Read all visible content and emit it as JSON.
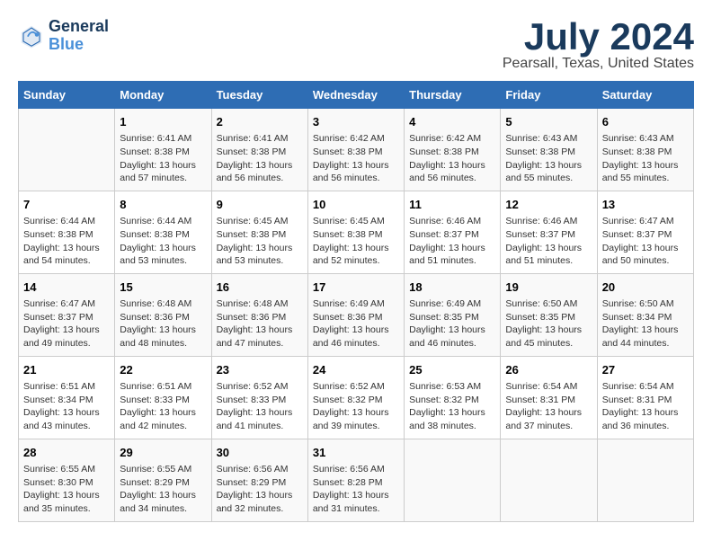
{
  "header": {
    "logo_line1": "General",
    "logo_line2": "Blue",
    "title": "July 2024",
    "subtitle": "Pearsall, Texas, United States"
  },
  "calendar": {
    "days_of_week": [
      "Sunday",
      "Monday",
      "Tuesday",
      "Wednesday",
      "Thursday",
      "Friday",
      "Saturday"
    ],
    "weeks": [
      [
        {
          "day": "",
          "content": ""
        },
        {
          "day": "1",
          "content": "Sunrise: 6:41 AM\nSunset: 8:38 PM\nDaylight: 13 hours\nand 57 minutes."
        },
        {
          "day": "2",
          "content": "Sunrise: 6:41 AM\nSunset: 8:38 PM\nDaylight: 13 hours\nand 56 minutes."
        },
        {
          "day": "3",
          "content": "Sunrise: 6:42 AM\nSunset: 8:38 PM\nDaylight: 13 hours\nand 56 minutes."
        },
        {
          "day": "4",
          "content": "Sunrise: 6:42 AM\nSunset: 8:38 PM\nDaylight: 13 hours\nand 56 minutes."
        },
        {
          "day": "5",
          "content": "Sunrise: 6:43 AM\nSunset: 8:38 PM\nDaylight: 13 hours\nand 55 minutes."
        },
        {
          "day": "6",
          "content": "Sunrise: 6:43 AM\nSunset: 8:38 PM\nDaylight: 13 hours\nand 55 minutes."
        }
      ],
      [
        {
          "day": "7",
          "content": "Sunrise: 6:44 AM\nSunset: 8:38 PM\nDaylight: 13 hours\nand 54 minutes."
        },
        {
          "day": "8",
          "content": "Sunrise: 6:44 AM\nSunset: 8:38 PM\nDaylight: 13 hours\nand 53 minutes."
        },
        {
          "day": "9",
          "content": "Sunrise: 6:45 AM\nSunset: 8:38 PM\nDaylight: 13 hours\nand 53 minutes."
        },
        {
          "day": "10",
          "content": "Sunrise: 6:45 AM\nSunset: 8:38 PM\nDaylight: 13 hours\nand 52 minutes."
        },
        {
          "day": "11",
          "content": "Sunrise: 6:46 AM\nSunset: 8:37 PM\nDaylight: 13 hours\nand 51 minutes."
        },
        {
          "day": "12",
          "content": "Sunrise: 6:46 AM\nSunset: 8:37 PM\nDaylight: 13 hours\nand 51 minutes."
        },
        {
          "day": "13",
          "content": "Sunrise: 6:47 AM\nSunset: 8:37 PM\nDaylight: 13 hours\nand 50 minutes."
        }
      ],
      [
        {
          "day": "14",
          "content": "Sunrise: 6:47 AM\nSunset: 8:37 PM\nDaylight: 13 hours\nand 49 minutes."
        },
        {
          "day": "15",
          "content": "Sunrise: 6:48 AM\nSunset: 8:36 PM\nDaylight: 13 hours\nand 48 minutes."
        },
        {
          "day": "16",
          "content": "Sunrise: 6:48 AM\nSunset: 8:36 PM\nDaylight: 13 hours\nand 47 minutes."
        },
        {
          "day": "17",
          "content": "Sunrise: 6:49 AM\nSunset: 8:36 PM\nDaylight: 13 hours\nand 46 minutes."
        },
        {
          "day": "18",
          "content": "Sunrise: 6:49 AM\nSunset: 8:35 PM\nDaylight: 13 hours\nand 46 minutes."
        },
        {
          "day": "19",
          "content": "Sunrise: 6:50 AM\nSunset: 8:35 PM\nDaylight: 13 hours\nand 45 minutes."
        },
        {
          "day": "20",
          "content": "Sunrise: 6:50 AM\nSunset: 8:34 PM\nDaylight: 13 hours\nand 44 minutes."
        }
      ],
      [
        {
          "day": "21",
          "content": "Sunrise: 6:51 AM\nSunset: 8:34 PM\nDaylight: 13 hours\nand 43 minutes."
        },
        {
          "day": "22",
          "content": "Sunrise: 6:51 AM\nSunset: 8:33 PM\nDaylight: 13 hours\nand 42 minutes."
        },
        {
          "day": "23",
          "content": "Sunrise: 6:52 AM\nSunset: 8:33 PM\nDaylight: 13 hours\nand 41 minutes."
        },
        {
          "day": "24",
          "content": "Sunrise: 6:52 AM\nSunset: 8:32 PM\nDaylight: 13 hours\nand 39 minutes."
        },
        {
          "day": "25",
          "content": "Sunrise: 6:53 AM\nSunset: 8:32 PM\nDaylight: 13 hours\nand 38 minutes."
        },
        {
          "day": "26",
          "content": "Sunrise: 6:54 AM\nSunset: 8:31 PM\nDaylight: 13 hours\nand 37 minutes."
        },
        {
          "day": "27",
          "content": "Sunrise: 6:54 AM\nSunset: 8:31 PM\nDaylight: 13 hours\nand 36 minutes."
        }
      ],
      [
        {
          "day": "28",
          "content": "Sunrise: 6:55 AM\nSunset: 8:30 PM\nDaylight: 13 hours\nand 35 minutes."
        },
        {
          "day": "29",
          "content": "Sunrise: 6:55 AM\nSunset: 8:29 PM\nDaylight: 13 hours\nand 34 minutes."
        },
        {
          "day": "30",
          "content": "Sunrise: 6:56 AM\nSunset: 8:29 PM\nDaylight: 13 hours\nand 32 minutes."
        },
        {
          "day": "31",
          "content": "Sunrise: 6:56 AM\nSunset: 8:28 PM\nDaylight: 13 hours\nand 31 minutes."
        },
        {
          "day": "",
          "content": ""
        },
        {
          "day": "",
          "content": ""
        },
        {
          "day": "",
          "content": ""
        }
      ]
    ]
  }
}
